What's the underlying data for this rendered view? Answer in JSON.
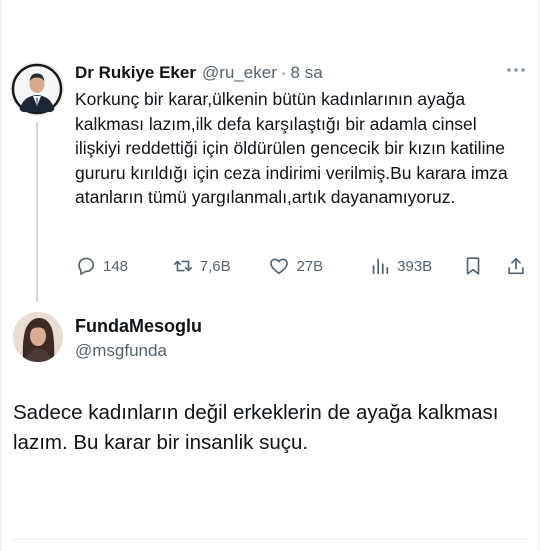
{
  "quoted_tweet": {
    "author_name": "Dr Rukiye Eker",
    "author_handle": "@ru_eker",
    "separator": "·",
    "time": "8 sa",
    "more_icon": "more-horizontal-icon",
    "text": "Korkunç bir karar,ülkenin bütün kadınlarının ayağa kalkması lazım,ilk defa karşılaştığı bir adamla cinsel ilişkiyi reddettiği için öldürülen gencecik bir kızın katiline gururu kırıldığı için ceza indirimi verilmiş.Bu karara imza atanların tümü yargılanmalı,artık dayanamıyoruz.",
    "replies": "148",
    "retweets": "7,6B",
    "likes": "27B",
    "views": "393B"
  },
  "main_tweet": {
    "author_name": "FundaMesoglu",
    "author_handle": "@msgfunda",
    "text": "Sadece kadınların değil erkeklerin  de ayağa kalkması lazım. Bu karar bir insanlik suçu."
  },
  "colors": {
    "text": "#0f1419",
    "secondary": "#536471",
    "thread_line": "#cfd9de"
  }
}
